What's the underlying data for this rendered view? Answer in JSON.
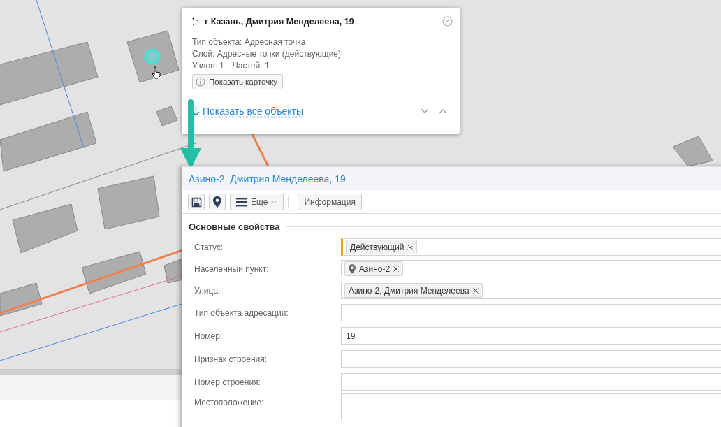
{
  "popup": {
    "title": "г Казань, Дмитрия Менделеева, 19",
    "lines": [
      "Тип объекта: Адресная точка",
      "Слой: Адресные точки (действующие)"
    ],
    "stats": [
      "Узлов: 1",
      "Частей: 1"
    ],
    "card_button": "Показать карточку",
    "show_all_link": "Показать все объекты"
  },
  "panel": {
    "title": "Азино-2, Дмитрия Менделеева, 19",
    "more_button": "Еще",
    "info_button": "Информация",
    "section": "Основные свойства",
    "fields": [
      {
        "label": "Статус:",
        "kind": "tags",
        "marked": true,
        "tags": [
          {
            "text": "Действующий",
            "kind": "plain"
          }
        ]
      },
      {
        "label": "Населенный пункт:",
        "kind": "tags",
        "marked": false,
        "tags": [
          {
            "text": "Азино-2",
            "kind": "place"
          }
        ]
      },
      {
        "label": "Улица:",
        "kind": "tags",
        "marked": false,
        "tags": [
          {
            "text": "Азино-2, Дмитрия Менделеева",
            "kind": "plain"
          }
        ]
      },
      {
        "label": "Тип объекта адресации:",
        "kind": "text",
        "marked": false
      },
      {
        "label": "Номер:",
        "kind": "text",
        "marked": false,
        "value": "19"
      },
      {
        "label": "Признак строения:",
        "kind": "text",
        "marked": false
      },
      {
        "label": "Номер строения:",
        "kind": "text",
        "marked": false
      },
      {
        "label": "Местоположение:",
        "kind": "area",
        "marked": false
      }
    ]
  }
}
